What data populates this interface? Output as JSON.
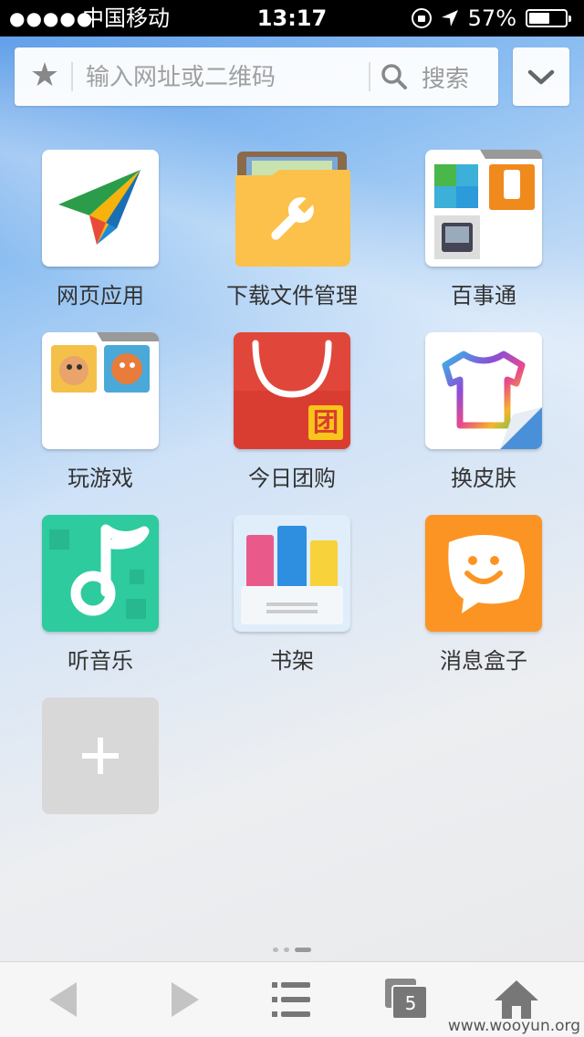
{
  "status": {
    "signal": "●●●●●",
    "carrier": "中国移动",
    "time": "13:17",
    "battery_percent": "57%",
    "battery_level": 0.57
  },
  "search": {
    "placeholder": "输入网址或二维码",
    "button_label": "搜索"
  },
  "tiles": [
    {
      "label": "网页应用",
      "icon": "paper-plane-icon"
    },
    {
      "label": "下载文件管理",
      "icon": "folder-wrench-icon"
    },
    {
      "label": "百事通",
      "icon": "services-folder-icon"
    },
    {
      "label": "玩游戏",
      "icon": "games-folder-icon"
    },
    {
      "label": "今日团购",
      "icon": "shopping-bag-icon"
    },
    {
      "label": "换皮肤",
      "icon": "tshirt-icon"
    },
    {
      "label": "听音乐",
      "icon": "music-note-icon"
    },
    {
      "label": "书架",
      "icon": "bookshelf-icon"
    },
    {
      "label": "消息盒子",
      "icon": "smiley-bubble-icon"
    }
  ],
  "shop_badge": "团",
  "tabs_count": "5",
  "watermark": "www.wooyun.org"
}
